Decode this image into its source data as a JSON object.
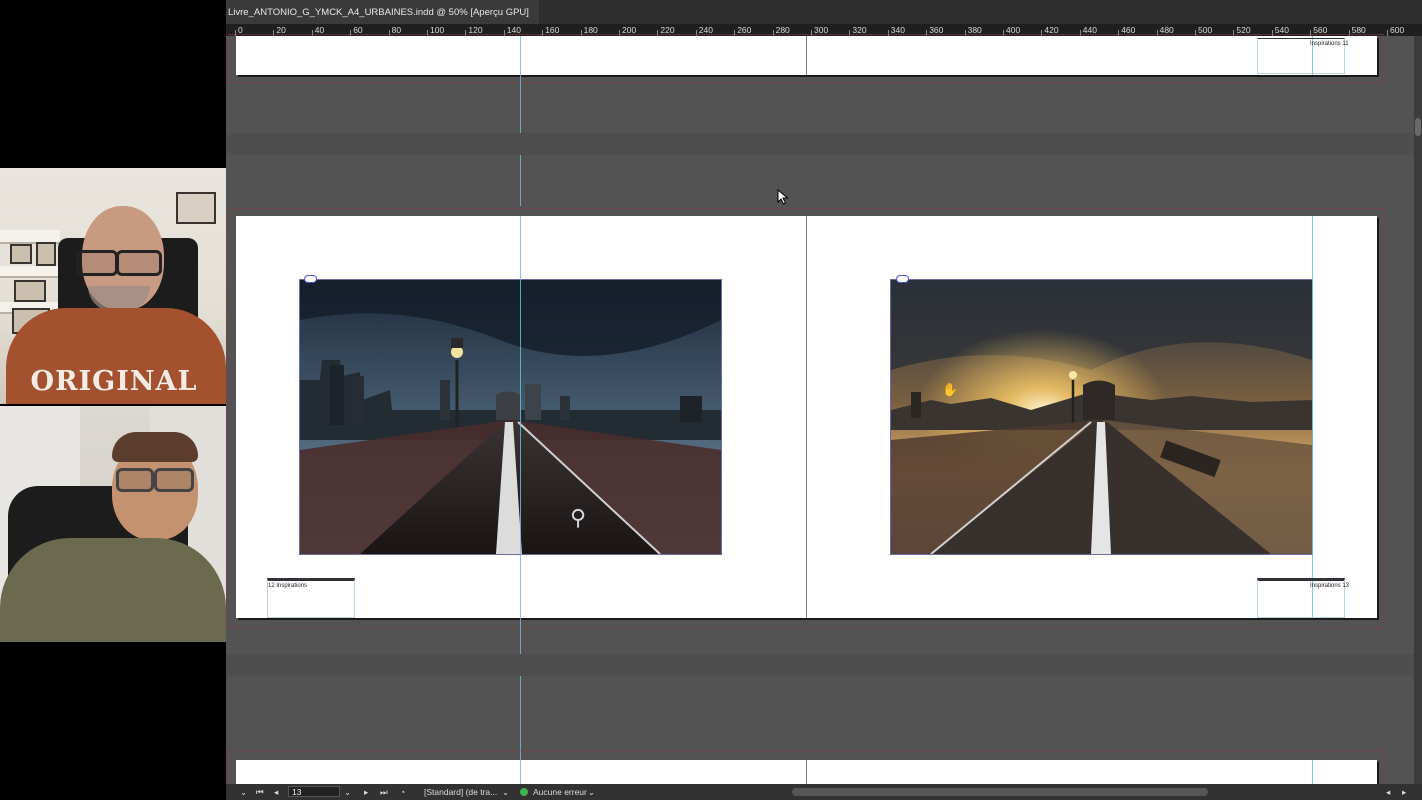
{
  "window": {
    "document_tab": "Livre_ANTONIO_G_YMCK_A4_URBAINES.indd @ 50% [Aperçu GPU]"
  },
  "ruler": {
    "ticks": [
      "0",
      "20",
      "40",
      "60",
      "80",
      "100",
      "120",
      "140",
      "160",
      "180",
      "200",
      "220",
      "240",
      "260",
      "280",
      "300",
      "320",
      "340",
      "360",
      "380",
      "400",
      "420",
      "440",
      "460",
      "480",
      "500",
      "520",
      "540",
      "560",
      "580",
      "600"
    ]
  },
  "spreads": {
    "top": {
      "right_folio": "Inspirations 11"
    },
    "main": {
      "left_folio": "12 Inspirations",
      "right_folio": "Inspirations 13",
      "left_image": "Brooklyn Bridge at dusk with lamp post and bike lane",
      "right_image": "Brooklyn Bridge at sunrise with bench and sunburst"
    }
  },
  "statusbar": {
    "page_number": "13",
    "master": "[Standard] (de tra...",
    "preflight": "Aucune erreur",
    "preflight_color": "#3fb34f"
  },
  "webcams": {
    "top_shirt_text": "ORIGINAL"
  },
  "colors": {
    "pasteboard": "#535353",
    "guide": "#5fc4d6",
    "bleed": "#8a3b46",
    "frame_edge": "#4b55d8"
  }
}
